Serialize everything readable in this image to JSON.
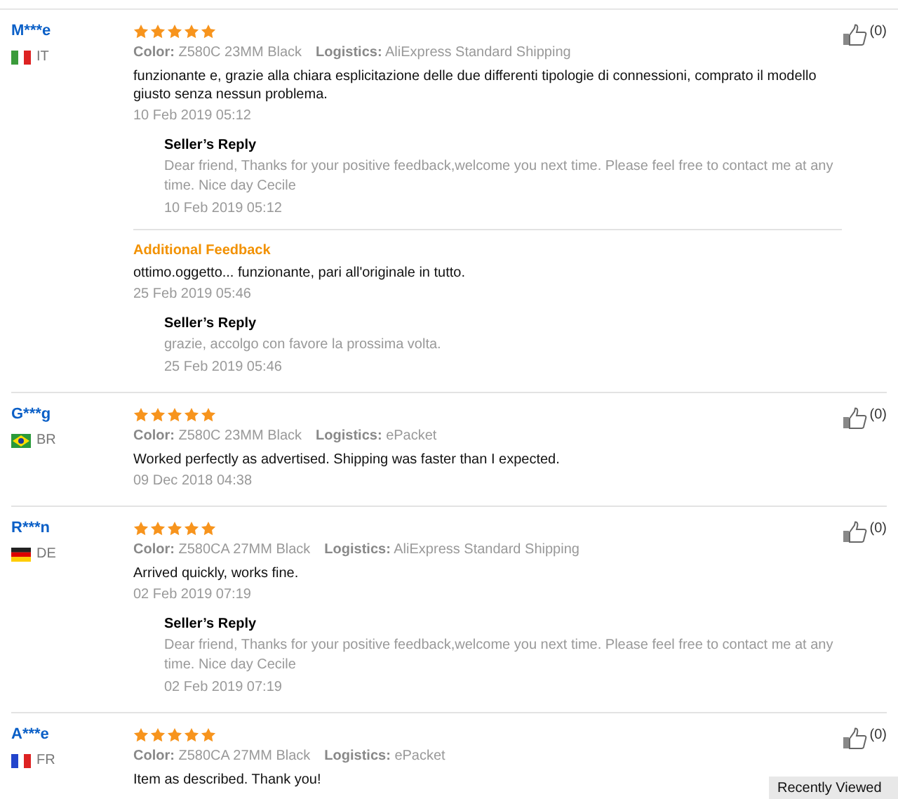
{
  "reviews": [
    {
      "user": "M***e",
      "kind": "italy",
      "country": "IT",
      "stars": 5,
      "color_label": "Color:",
      "variant": "Z580C 23MM Black",
      "logistics_label": "Logistics:",
      "logistics": "AliExpress Standard Shipping",
      "text": "funzionante e, grazie alla chiara esplicitazione delle due differenti tipologie di connessioni, comprato il modello giusto senza nessun problema.",
      "date": "10 Feb 2019 05:12",
      "likes": "(0)",
      "seller_reply": {
        "title": "Seller’s Reply",
        "text": "Dear friend, Thanks for your positive feedback,welcome you next time. Please feel free to contact me at any time. Nice day Cecile",
        "date": "10 Feb 2019 05:12"
      },
      "additional": {
        "title": "Additional Feedback",
        "text": "ottimo.oggetto... funzionante, pari all'originale in tutto.",
        "date": "25 Feb 2019 05:46",
        "seller_reply": {
          "title": "Seller’s Reply",
          "text": "grazie, accolgo con favore la prossima volta.",
          "date": "25 Feb 2019 05:46"
        }
      }
    },
    {
      "user": "G***g",
      "kind": "brazil",
      "country": "BR",
      "stars": 5,
      "color_label": "Color:",
      "variant": "Z580C 23MM Black",
      "logistics_label": "Logistics:",
      "logistics": "ePacket",
      "text": "Worked perfectly as advertised. Shipping was faster than I expected.",
      "date": "09 Dec 2018 04:38",
      "likes": "(0)"
    },
    {
      "user": "R***n",
      "kind": "germany",
      "country": "DE",
      "stars": 5,
      "color_label": "Color:",
      "variant": "Z580CA 27MM Black",
      "logistics_label": "Logistics:",
      "logistics": "AliExpress Standard Shipping",
      "text": "Arrived quickly, works fine.",
      "date": "02 Feb 2019 07:19",
      "likes": "(0)",
      "seller_reply": {
        "title": "Seller’s Reply",
        "text": "Dear friend, Thanks for your positive feedback,welcome you next time. Please feel free to contact me at any time. Nice day Cecile",
        "date": "02 Feb 2019 07:19"
      }
    },
    {
      "user": "A***e",
      "kind": "france",
      "country": "FR",
      "stars": 5,
      "color_label": "Color:",
      "variant": "Z580CA 27MM Black",
      "logistics_label": "Logistics:",
      "logistics": "ePacket",
      "text": "Item as described. Thank you!",
      "likes": "(0)"
    }
  ],
  "recently_viewed": "Recently Viewed"
}
